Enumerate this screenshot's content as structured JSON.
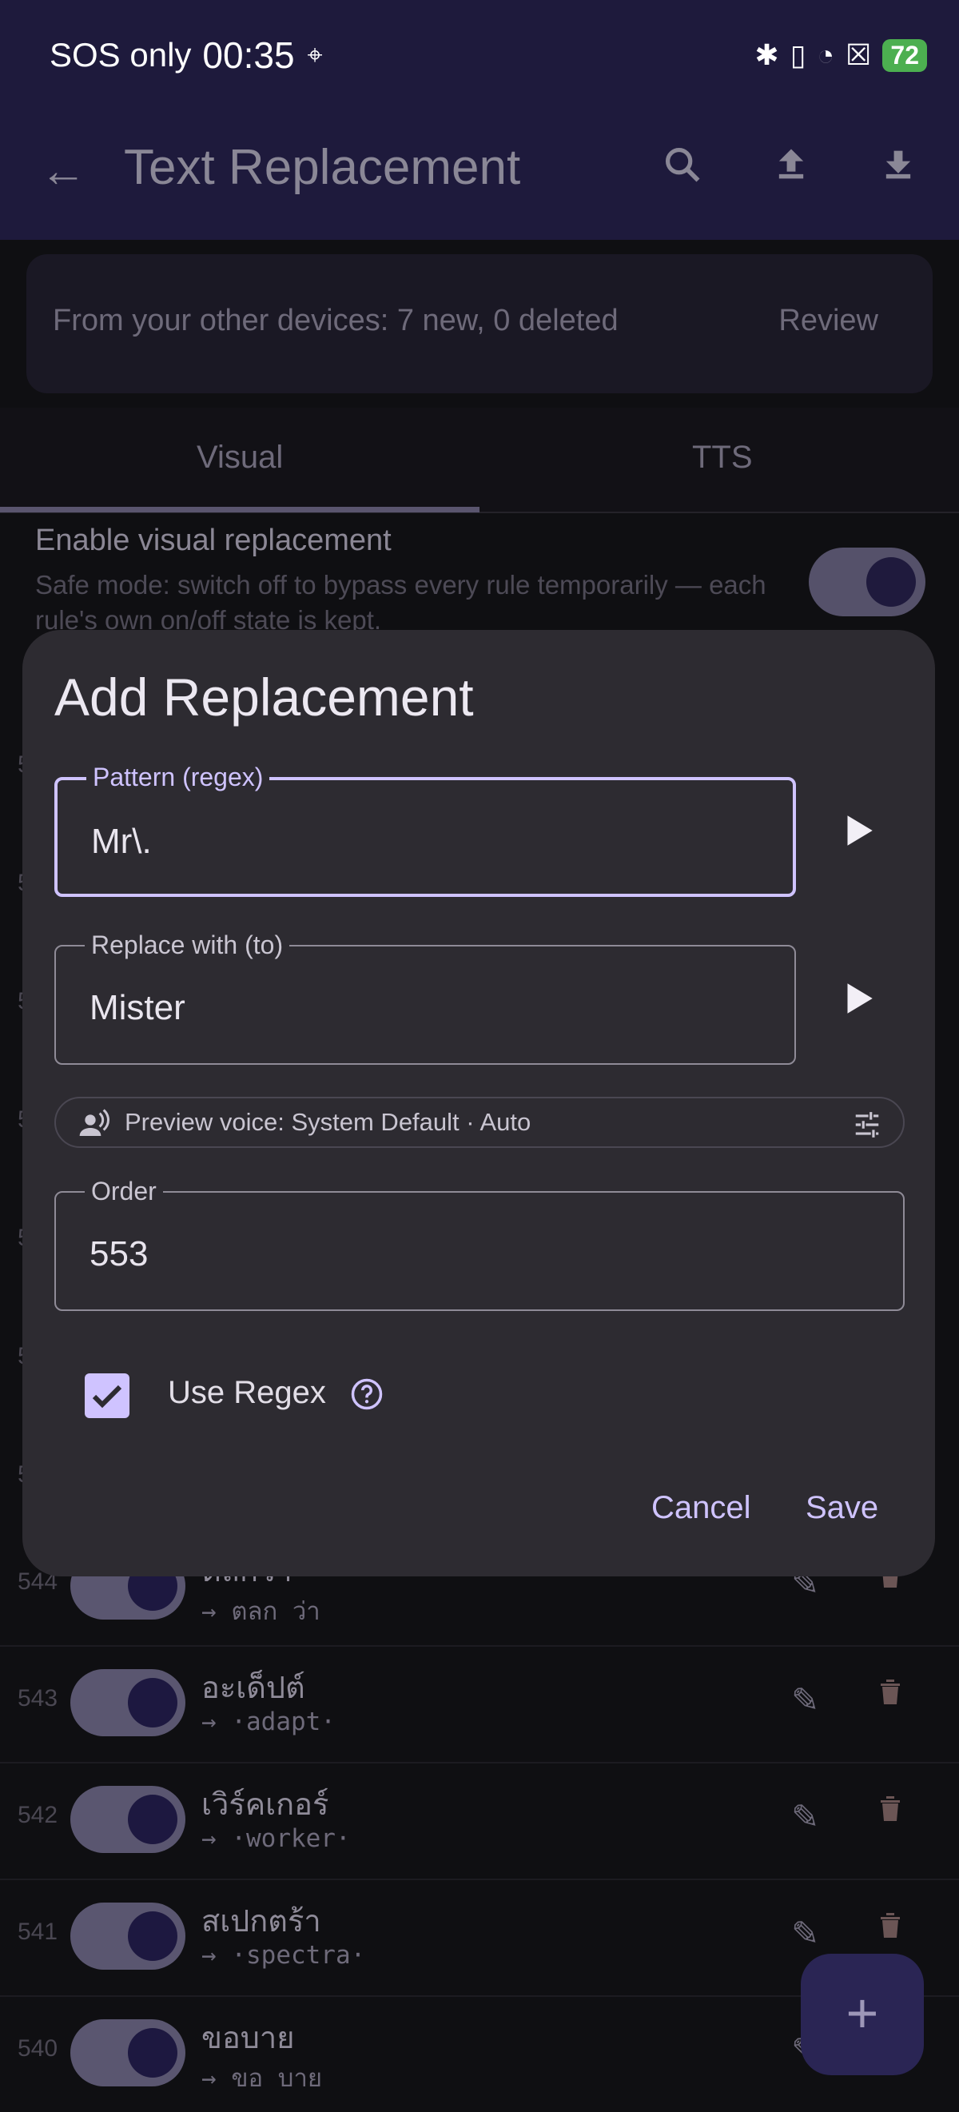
{
  "status_bar": {
    "carrier": "SOS only",
    "time": "00:35",
    "battery": "72"
  },
  "app_bar": {
    "title": "Text Replacement",
    "icons": [
      "back-arrow-icon",
      "search-icon",
      "upload-icon",
      "download-icon"
    ]
  },
  "sync_banner": {
    "message": "From your other devices: 7 new, 0 deleted",
    "action": "Review"
  },
  "tabs": [
    {
      "label": "Visual",
      "selected": true
    },
    {
      "label": "TTS",
      "selected": false
    }
  ],
  "visual_setting": {
    "title": "Enable visual replacement",
    "subtitle": "Safe mode: switch off to bypass every rule temporarily — each rule's own on/off state is kept.",
    "enabled": true
  },
  "rules": [
    {
      "order": "544",
      "from": "ตลกว่า",
      "to": "→ ตลก ว่า"
    },
    {
      "order": "543",
      "from": "อะเด็ปต์",
      "to": "→ ·adapt·"
    },
    {
      "order": "542",
      "from": "เวิร์คเกอร์",
      "to": "→ ·worker·"
    },
    {
      "order": "541",
      "from": "สเปกตร้า",
      "to": "→ ·spectra·"
    },
    {
      "order": "540",
      "from": "ขอบาย",
      "to": "→ ขอ บาย"
    }
  ],
  "hidden_rule_numbers": [
    "5",
    "5",
    "5",
    "5",
    "5",
    "5",
    "5"
  ],
  "dialog": {
    "title": "Add Replacement",
    "pattern_label": "Pattern (regex)",
    "pattern_value": "Mr\\.",
    "replace_label": "Replace with (to)",
    "replace_value": "Mister",
    "voice_chip": "Preview voice: System Default · Auto",
    "order_label": "Order",
    "order_value": "553",
    "use_regex_label": "Use Regex",
    "use_regex_checked": true,
    "cancel": "Cancel",
    "save": "Save"
  },
  "fab": "+",
  "colors": {
    "accent": "#cfc3ff",
    "app_bar": "#1e1a3c",
    "dialog": "#2d2b31",
    "battery": "#4caf50"
  }
}
